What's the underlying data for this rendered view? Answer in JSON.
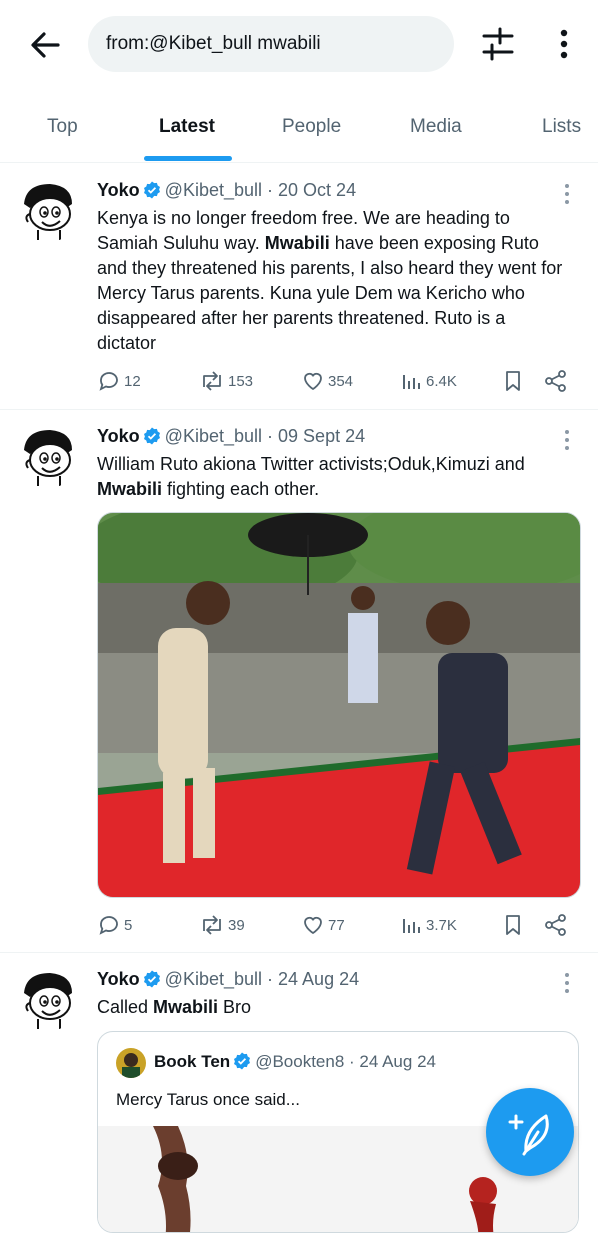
{
  "search": {
    "query": "from:@Kibet_bull mwabili"
  },
  "tabs": [
    {
      "label": "Top"
    },
    {
      "label": "Latest"
    },
    {
      "label": "People"
    },
    {
      "label": "Media"
    },
    {
      "label": "Lists"
    }
  ],
  "active_tab": "Latest",
  "tweets": [
    {
      "name": "Yoko",
      "handle": "@Kibet_bull",
      "date": "· 20 Oct 24",
      "text_parts": [
        "Kenya is no longer freedom free. We are heading to Samiah Suluhu way. ",
        "Mwabili",
        " have been  exposing Ruto and they threatened his parents, I also heard they went for Mercy Tarus parents. Kuna yule Dem wa Kericho who disappeared after her parents threatened. Ruto is a dictator"
      ],
      "replies": "12",
      "reposts": "153",
      "likes": "354",
      "views": "6.4K"
    },
    {
      "name": "Yoko",
      "handle": "@Kibet_bull",
      "date": "· 09 Sept 24",
      "text_parts": [
        "William Ruto akiona Twitter activists;Oduk,Kimuzi and ",
        "Mwabili",
        " fighting each other."
      ],
      "replies": "5",
      "reposts": "39",
      "likes": "77",
      "views": "3.7K"
    },
    {
      "name": "Yoko",
      "handle": "@Kibet_bull",
      "date": "· 24 Aug 24",
      "text_parts": [
        "Called ",
        "Mwabili",
        " Bro"
      ],
      "quote": {
        "name": "Book Ten",
        "handle": "@Bookten8",
        "date": "· 24 Aug 24",
        "text": "Mercy Tarus once said..."
      }
    }
  ],
  "colors": {
    "accent": "#1d9bf0",
    "text": "#0f1419",
    "secondary": "#536471"
  }
}
